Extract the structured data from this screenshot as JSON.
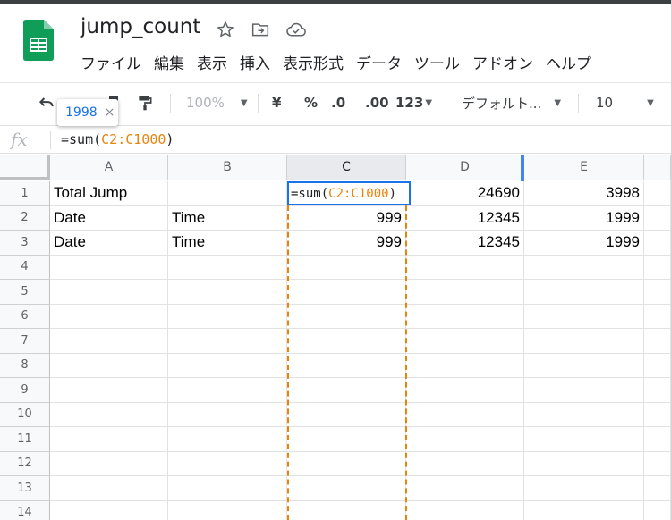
{
  "doc": {
    "title": "jump_count"
  },
  "menu": [
    "ファイル",
    "編集",
    "表示",
    "挿入",
    "表示形式",
    "データ",
    "ツール",
    "アドオン",
    "ヘルプ"
  ],
  "toolbar": {
    "zoom": "100%",
    "currency": "¥",
    "percent": "%",
    "decrease_decimal": ".0",
    "increase_decimal": ".00",
    "more_formats": "123",
    "font": "デフォルト...",
    "font_size": "10"
  },
  "tooltip": {
    "value": "1998",
    "close": "×"
  },
  "formula_bar": {
    "fx": "fx",
    "prefix": "=sum(",
    "range": "C2:C1000",
    "suffix": ")"
  },
  "grid": {
    "columns": [
      "A",
      "B",
      "C",
      "D",
      "E"
    ],
    "rows": [
      "1",
      "2",
      "3",
      "4",
      "5",
      "6",
      "7",
      "8",
      "9",
      "10",
      "11",
      "12",
      "13",
      "14"
    ],
    "cells": {
      "A1": "Total Jump",
      "D1": "24690",
      "E1": "3998",
      "A2": "Date",
      "B2": "Time",
      "C2": "999",
      "D2": "12345",
      "E2": "1999",
      "A3": "Date",
      "B3": "Time",
      "C3": "999",
      "D3": "12345",
      "E3": "1999"
    },
    "editing_cell": {
      "prefix": "=sum(",
      "range": "C2:C1000",
      "suffix": ")"
    }
  },
  "colors": {
    "accent": "#1a73e8",
    "range_highlight": "#e8830c",
    "sheets_green": "#0f9d58"
  },
  "icons": [
    "sheets-logo-icon",
    "star-icon",
    "move-folder-icon",
    "cloud-saved-icon",
    "undo-icon",
    "paint-format-icon"
  ]
}
